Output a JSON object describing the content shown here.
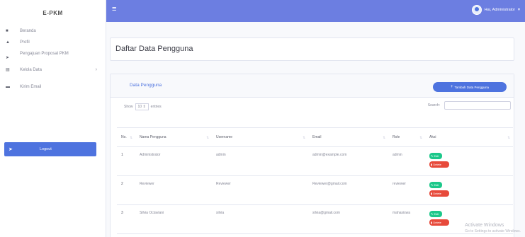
{
  "sidebar": {
    "brand": "E-PKM",
    "items": [
      {
        "icon": "home-icon",
        "label": "Beranda"
      },
      {
        "icon": "user-icon",
        "label": "Profil"
      },
      {
        "icon": "send-icon",
        "label": "Pengajuan Proposal PKM"
      },
      {
        "icon": "grid-icon",
        "label": "Kelola Data"
      },
      {
        "icon": "list-icon",
        "label": "Kirim Email"
      }
    ],
    "logout": "Logout"
  },
  "topbar": {
    "greeting": "Hai, Administrator"
  },
  "page": {
    "title": "Daftar Data Pengguna"
  },
  "card": {
    "title": "Data Pengguna",
    "add_button": "Tambah Data Pengguna",
    "show_label": "Show",
    "show_value": "10",
    "entries_label": "entries",
    "search_label": "Search:"
  },
  "table": {
    "headers": [
      "No.",
      "Nama Pengguna",
      "Username",
      "Email",
      "Role",
      "Aksi"
    ],
    "rows": [
      {
        "no": "1",
        "name": "Administrator",
        "username": "admin",
        "email": "admin@example.com",
        "role": "admin"
      },
      {
        "no": "2",
        "name": "Reviewer",
        "username": "Reviewer",
        "email": "Reviewer@gmail.com",
        "role": "reviewer"
      },
      {
        "no": "3",
        "name": "Silvia Octaviani",
        "username": "silvia",
        "email": "silvia@gmail.com",
        "role": "mahasiswa"
      }
    ],
    "edit_label": "Edit",
    "delete_label": "Delete"
  },
  "watermark": {
    "line1": "Activate Windows",
    "line2": "Go to Settings to activate Windows."
  }
}
